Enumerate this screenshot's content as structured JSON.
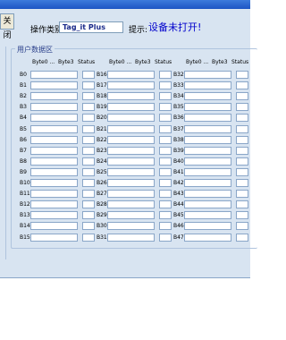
{
  "close_button": "关闭",
  "op_type_label": "操作类别:",
  "op_type_value": "Tag_it Plus",
  "tip_label": "提示:",
  "tip_value": "设备未打开!",
  "group_title": "用户数据区",
  "column_headers": {
    "byte0": "Byte0 ...",
    "byte3": "Byte3",
    "status": "Status"
  },
  "blocks": [
    [
      "B0",
      "B16",
      "B32"
    ],
    [
      "B1",
      "B17",
      "B33"
    ],
    [
      "B2",
      "B18",
      "B34"
    ],
    [
      "B3",
      "B19",
      "B35"
    ],
    [
      "B4",
      "B20",
      "B36"
    ],
    [
      "B5",
      "B21",
      "B37"
    ],
    [
      "B6",
      "B22",
      "B38"
    ],
    [
      "B7",
      "B23",
      "B39"
    ],
    [
      "B8",
      "B24",
      "B40"
    ],
    [
      "B9",
      "B25",
      "B41"
    ],
    [
      "B10",
      "B26",
      "B42"
    ],
    [
      "B11",
      "B27",
      "B43"
    ],
    [
      "B12",
      "B28",
      "B44"
    ],
    [
      "B13",
      "B29",
      "B45"
    ],
    [
      "B14",
      "B30",
      "B46"
    ],
    [
      "B15",
      "B31",
      "B47"
    ]
  ]
}
